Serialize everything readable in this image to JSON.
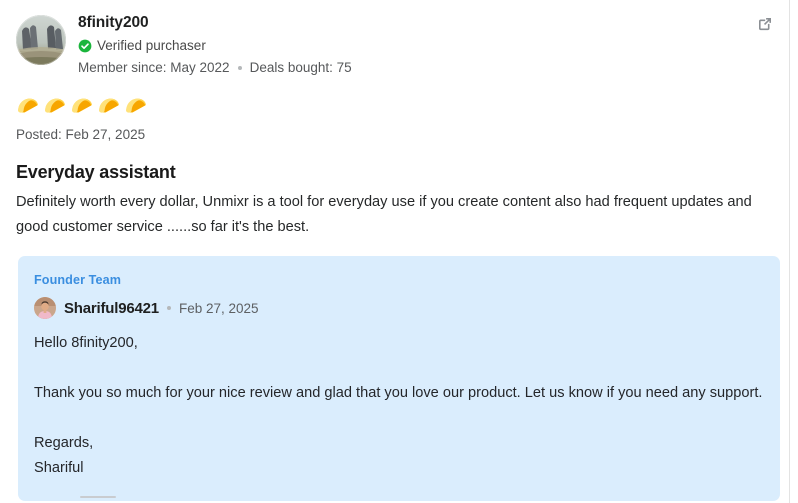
{
  "reviewer": {
    "username": "8finity200",
    "verified_label": "Verified purchaser",
    "member_since": "Member since: May 2022",
    "deals_bought": "Deals bought: 75",
    "avatar_icon": "user-photo-avatar"
  },
  "rating": {
    "icon": "taco-icon",
    "value": 5,
    "max": 5
  },
  "posted": "Posted: Feb 27, 2025",
  "review": {
    "title": "Everyday assistant",
    "text": "Definitely worth every dollar, Unmixr is a tool for everyday use if you create content also had frequent updates and good customer service ......so far it's the best."
  },
  "reply": {
    "tag": "Founder Team",
    "author": "Shariful96421",
    "date": "Feb 27, 2025",
    "avatar_icon": "founder-photo-avatar",
    "greeting": "Hello 8finity200,",
    "paragraph": "Thank you so much for your nice review and glad that you love our product. Let us know if you need any support.",
    "signoff": "Regards,",
    "signature": "Shariful"
  },
  "actions": {
    "external_link_icon": "external-link-icon"
  },
  "colors": {
    "reply_background": "#daedfd",
    "founder_tag": "#3a8ee0",
    "verified_green": "#1bb53c",
    "taco_yellow": "#f5b400"
  }
}
